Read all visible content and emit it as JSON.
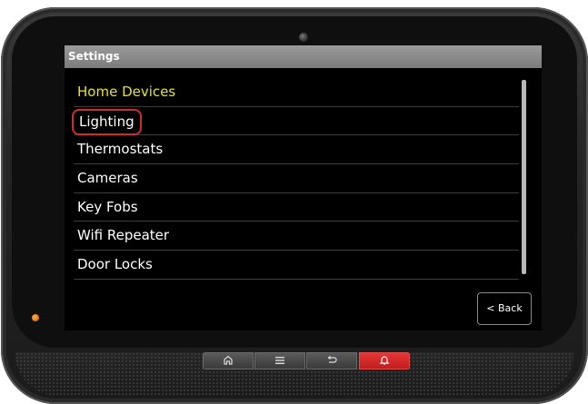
{
  "screen": {
    "title": "Settings",
    "items": [
      {
        "label": "Home Devices",
        "type": "header"
      },
      {
        "label": "Lighting",
        "highlighted": true
      },
      {
        "label": "Thermostats"
      },
      {
        "label": "Cameras"
      },
      {
        "label": "Key Fobs"
      },
      {
        "label": "Wifi Repeater"
      },
      {
        "label": "Door Locks"
      }
    ],
    "back_label": "< Back"
  },
  "hardware_buttons": [
    {
      "icon": "home-icon"
    },
    {
      "icon": "menu-icon"
    },
    {
      "icon": "return-icon"
    },
    {
      "icon": "alarm-bell-icon"
    }
  ],
  "colors": {
    "section_header": "#e8e02a",
    "highlight_outline": "#d12c2c",
    "alarm_button": "#d42626",
    "status_led": "#e07a10"
  }
}
